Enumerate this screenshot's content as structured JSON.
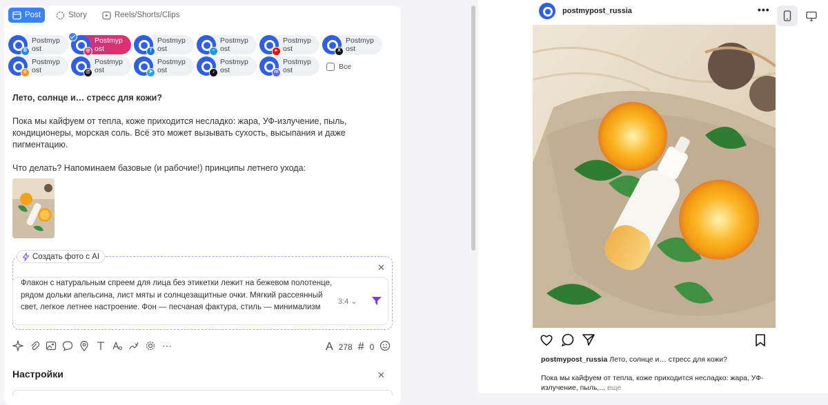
{
  "tabs": [
    {
      "label": "Post",
      "active": true,
      "icon": "post-icon"
    },
    {
      "label": "Story",
      "active": false,
      "icon": "story-icon"
    },
    {
      "label": "Reels/Shorts/Clips",
      "active": false,
      "icon": "reels-icon"
    }
  ],
  "accounts": [
    {
      "line1": "Postmyp",
      "line2": "ost",
      "network": "vk",
      "color": "#2787f5",
      "selected": false
    },
    {
      "line1": "Postmyp",
      "line2": "ost",
      "network": "instagram",
      "color": "#e1306c",
      "selected": true
    },
    {
      "line1": "Postmyp",
      "line2": "ost",
      "network": "facebook",
      "color": "#1877f2",
      "selected": false
    },
    {
      "line1": "Postmyp",
      "line2": "ost",
      "network": "bluesky",
      "color": "#1d9bf0",
      "selected": false
    },
    {
      "line1": "Postmyp",
      "line2": "ost",
      "network": "youtube",
      "color": "#ff0000",
      "selected": false
    },
    {
      "line1": "Postmyp",
      "line2": "ost",
      "network": "x",
      "color": "#111111",
      "selected": false
    },
    {
      "line1": "Postmyp",
      "line2": "ost",
      "network": "odnoklassniki",
      "color": "#f7931e",
      "selected": false
    },
    {
      "line1": "Postmyp",
      "line2": "ost",
      "network": "threads",
      "color": "#111111",
      "selected": false
    },
    {
      "line1": "Postmyp",
      "line2": "ost",
      "network": "telegram",
      "color": "#2aa3e0",
      "selected": false
    },
    {
      "line1": "Postmyp",
      "line2": "ost",
      "network": "tiktok",
      "color": "#111111",
      "selected": false
    },
    {
      "line1": "Postmyp",
      "line2": "ost",
      "network": "mastodon",
      "color": "#6364ff",
      "selected": false
    }
  ],
  "select_all_label": "Все",
  "post": {
    "title": "Лето, солнце и… стресс для кожи?",
    "p1": "Пока мы кайфуем от тепла, коже приходится несладко: жара, УФ-излучение, пыль, кондиционеры, морская соль. Всё это может вызывать сухость, высыпания и даже пигментацию.",
    "p2": "Что делать? Напоминаем базовые (и рабочие!) принципы летнего ухода:"
  },
  "ai": {
    "tag_label": "Создать фото с AI",
    "prompt": "Флакон с натуральным спреем для лица без этикетки лежит на бежевом полотенце, рядом дольки апельсина, лист мяты и солнцезащитные очки. Мягкий рассеянный свет, легкое летнее настроение. Фон — песчаная фактура, стиль — минимализм",
    "ratio": "3:4"
  },
  "counters": {
    "chars": "278",
    "hashtags": "0"
  },
  "settings_title": "Настройки",
  "preview": {
    "username": "postmypost_russia",
    "caption_title": "Лето, солнце и… стресс для кожи?",
    "body": "Пока мы кайфуем от тепла, коже приходится несладко: жара, УФ-излучение, пыль,...",
    "more": "еще"
  },
  "colors": {
    "accent": "#3b82f6",
    "brand": "#2f5fe3",
    "ai_border": "#b89cf0",
    "send": "#7c3aed"
  }
}
